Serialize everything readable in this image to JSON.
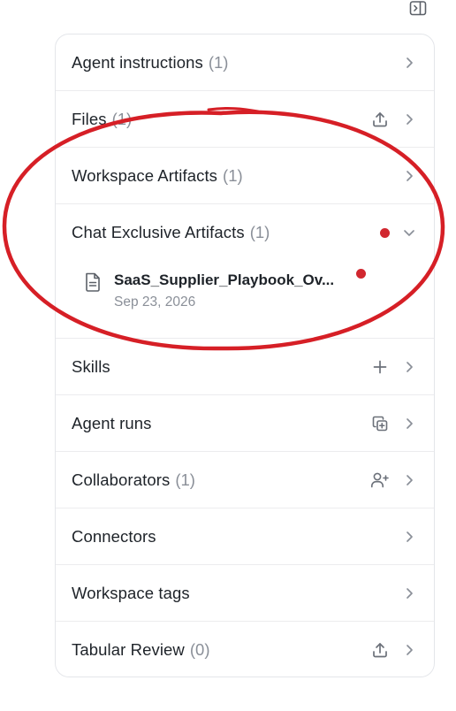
{
  "panel": {
    "items": [
      {
        "label": "Agent instructions",
        "count": "(1)",
        "action_icon": null
      },
      {
        "label": "Files",
        "count": "(1)",
        "action_icon": "upload-icon"
      },
      {
        "label": "Workspace Artifacts",
        "count": "(1)",
        "action_icon": null
      },
      {
        "label": "Chat Exclusive Artifacts",
        "count": "(1)",
        "action_icon": null,
        "expanded": true
      },
      {
        "label": "Skills",
        "count": "",
        "action_icon": "plus-icon"
      },
      {
        "label": "Agent runs",
        "count": "",
        "action_icon": "copy-plus-icon"
      },
      {
        "label": "Collaborators",
        "count": "(1)",
        "action_icon": "user-plus-icon"
      },
      {
        "label": "Connectors",
        "count": "",
        "action_icon": null
      },
      {
        "label": "Workspace tags",
        "count": "",
        "action_icon": null
      },
      {
        "label": "Tabular Review",
        "count": "(0)",
        "action_icon": "upload-icon"
      }
    ],
    "artifact": {
      "name": "SaaS_Supplier_Playbook_Ov...",
      "date": "Sep 23, 2026"
    }
  },
  "colors": {
    "notification_dot": "#d1272f",
    "annotation_ellipse": "#d61f26",
    "muted_text": "#8a8f98",
    "icon_stroke": "#6b7079"
  }
}
